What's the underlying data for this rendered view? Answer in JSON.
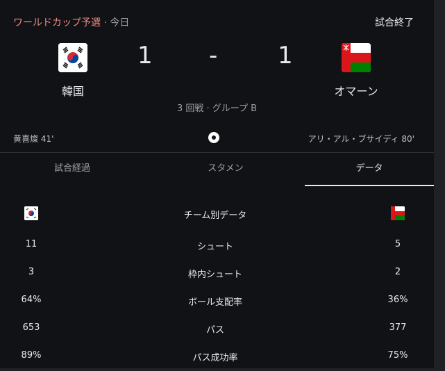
{
  "header": {
    "competition": "ワールドカップ予選",
    "separator": "·",
    "when": "今日",
    "status": "試合終了"
  },
  "match": {
    "home": {
      "name": "韓国",
      "flag_icon": "south-korea-flag-icon",
      "score": "1",
      "scorer": "黄喜燦 41'"
    },
    "away": {
      "name": "オマーン",
      "flag_icon": "oman-flag-icon",
      "score": "1",
      "scorer": "アリ・アル・ブサイディ 80'"
    },
    "dash": "-",
    "round": "3 回戦 · グループ B"
  },
  "tabs": [
    {
      "label": "試合経過",
      "active": false
    },
    {
      "label": "スタメン",
      "active": false
    },
    {
      "label": "データ",
      "active": true
    }
  ],
  "stats": {
    "title": "チーム別データ",
    "rows": [
      {
        "label": "シュート",
        "home": "11",
        "away": "5"
      },
      {
        "label": "枠内シュート",
        "home": "3",
        "away": "2"
      },
      {
        "label": "ボール支配率",
        "home": "64%",
        "away": "36%"
      },
      {
        "label": "パス",
        "home": "653",
        "away": "377"
      },
      {
        "label": "パス成功率",
        "home": "89%",
        "away": "75%"
      }
    ]
  },
  "colors": {
    "background": "#111216",
    "competition": "#f28b82",
    "muted": "#9aa0a6",
    "text": "#e8eaed",
    "korea_red": "#cd2e3a",
    "korea_blue": "#0047a0",
    "oman_red": "#db161b",
    "oman_green": "#008000"
  }
}
